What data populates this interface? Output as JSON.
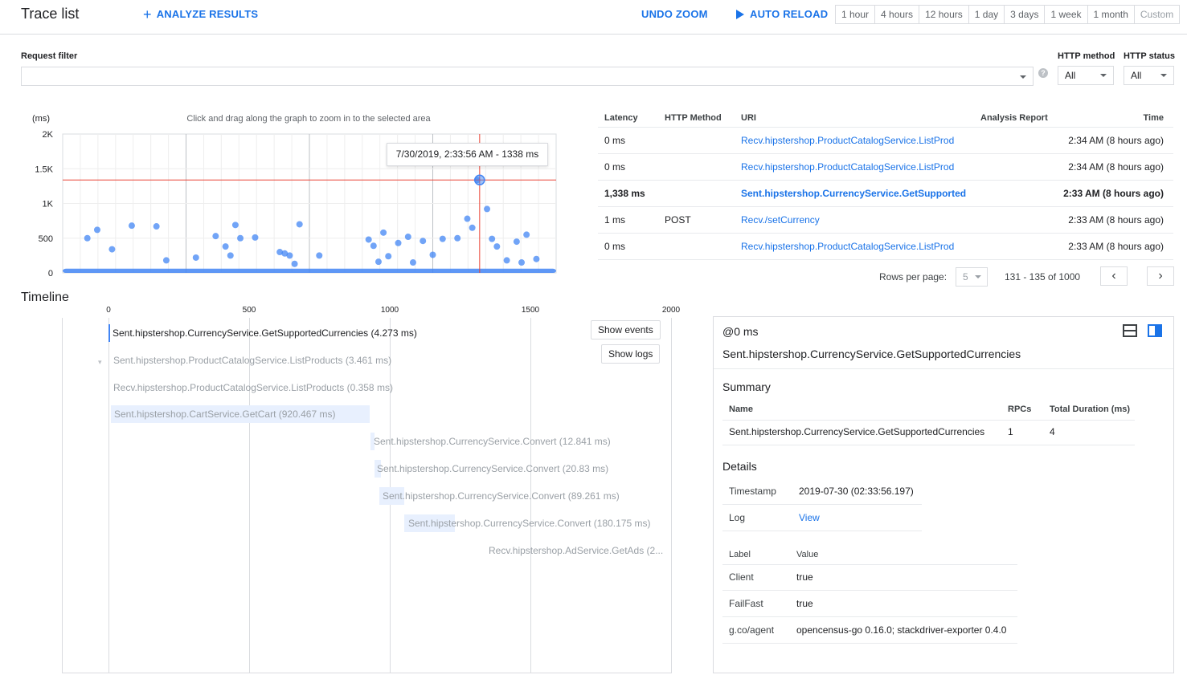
{
  "header": {
    "title": "Trace list",
    "analyze_label": "ANALYZE RESULTS",
    "undo_zoom_label": "UNDO ZOOM",
    "auto_reload_label": "AUTO RELOAD",
    "time_ranges": [
      "1 hour",
      "4 hours",
      "12 hours",
      "1 day",
      "3 days",
      "1 week",
      "1 month",
      "Custom"
    ]
  },
  "filter": {
    "request_filter_label": "Request filter",
    "help_glyph": "?",
    "http_method_label": "HTTP method",
    "http_method_value": "All",
    "http_status_label": "HTTP status",
    "http_status_value": "All"
  },
  "chart_data": {
    "type": "scatter",
    "ylabel": "(ms)",
    "instruction": "Click and drag along the graph to zoom in to the selected area",
    "y_ticks": [
      "2K",
      "1.5K",
      "1K",
      "500",
      "0"
    ],
    "ylim": [
      0,
      2000
    ],
    "xlim": [
      0,
      1
    ],
    "grid": true,
    "crosshair": {
      "x": 0.845,
      "y": 1338
    },
    "tooltip": "7/30/2019, 2:33:56 AM - 1338 ms",
    "points": [
      [
        0.05,
        500
      ],
      [
        0.07,
        620
      ],
      [
        0.1,
        340
      ],
      [
        0.14,
        680
      ],
      [
        0.19,
        670
      ],
      [
        0.21,
        180
      ],
      [
        0.27,
        220
      ],
      [
        0.31,
        530
      ],
      [
        0.33,
        380
      ],
      [
        0.34,
        250
      ],
      [
        0.35,
        690
      ],
      [
        0.36,
        500
      ],
      [
        0.39,
        510
      ],
      [
        0.44,
        300
      ],
      [
        0.45,
        280
      ],
      [
        0.46,
        250
      ],
      [
        0.47,
        130
      ],
      [
        0.48,
        700
      ],
      [
        0.52,
        250
      ],
      [
        0.62,
        480
      ],
      [
        0.63,
        390
      ],
      [
        0.64,
        160
      ],
      [
        0.65,
        580
      ],
      [
        0.66,
        240
      ],
      [
        0.68,
        430
      ],
      [
        0.7,
        520
      ],
      [
        0.71,
        150
      ],
      [
        0.73,
        460
      ],
      [
        0.75,
        260
      ],
      [
        0.77,
        490
      ],
      [
        0.8,
        500
      ],
      [
        0.82,
        780
      ],
      [
        0.83,
        650
      ],
      [
        0.84,
        1338
      ],
      [
        0.86,
        920
      ],
      [
        0.87,
        490
      ],
      [
        0.88,
        380
      ],
      [
        0.9,
        180
      ],
      [
        0.92,
        450
      ],
      [
        0.93,
        150
      ],
      [
        0.94,
        550
      ],
      [
        0.96,
        200
      ]
    ]
  },
  "trace_table": {
    "headers": [
      "Latency",
      "HTTP Method",
      "URI",
      "Analysis Report",
      "Time"
    ],
    "rows": [
      {
        "latency": "0 ms",
        "method": "",
        "uri": "Recv.hipstershop.ProductCatalogService.ListProd",
        "report": "",
        "time": "2:34 AM  (8 hours ago)"
      },
      {
        "latency": "0 ms",
        "method": "",
        "uri": "Recv.hipstershop.ProductCatalogService.ListProd",
        "report": "",
        "time": "2:34 AM  (8 hours ago)"
      },
      {
        "latency": "1,338 ms",
        "method": "",
        "uri": "Sent.hipstershop.CurrencyService.GetSupported",
        "report": "",
        "time": "2:33 AM  (8 hours ago)"
      },
      {
        "latency": "1 ms",
        "method": "POST",
        "uri": "Recv./setCurrency",
        "report": "",
        "time": "2:33 AM  (8 hours ago)"
      },
      {
        "latency": "0 ms",
        "method": "",
        "uri": "Recv.hipstershop.ProductCatalogService.ListProd",
        "report": "",
        "time": "2:33 AM  (8 hours ago)"
      }
    ],
    "rows_per_page_label": "Rows per page:",
    "rows_per_page": "5",
    "range_text": "131 - 135 of 1000",
    "prev_glyph": "‹",
    "next_glyph": "›"
  },
  "timeline": {
    "title": "Timeline",
    "ticks": [
      "0",
      "500",
      "1000",
      "1500",
      "2000"
    ],
    "show_events_label": "Show events",
    "show_logs_label": "Show logs",
    "spans": [
      {
        "label": "Sent.hipstershop.CurrencyService.GetSupportedCurrencies (4.273 ms)",
        "start": 0,
        "duration": 4.273
      },
      {
        "label": "Sent.hipstershop.ProductCatalogService.ListProducts (3.461 ms)",
        "start": 0,
        "duration": 3.461
      },
      {
        "label": "Recv.hipstershop.ProductCatalogService.ListProducts (0.358 ms)",
        "start": 0,
        "duration": 0.358
      },
      {
        "label": "Sent.hipstershop.CartService.GetCart (920.467 ms)",
        "start": 0,
        "duration": 920.467
      },
      {
        "label": "Sent.hipstershop.CurrencyService.Convert (12.841 ms)",
        "start": 930,
        "duration": 12.841
      },
      {
        "label": "Sent.hipstershop.CurrencyService.Convert (20.83 ms)",
        "start": 945,
        "duration": 20.83
      },
      {
        "label": "Sent.hipstershop.CurrencyService.Convert (89.261 ms)",
        "start": 968,
        "duration": 89.261
      },
      {
        "label": "Sent.hipstershop.CurrencyService.Convert (180.175 ms)",
        "start": 1060,
        "duration": 180.175
      },
      {
        "label": "Recv.hipstershop.AdService.GetAds (2...",
        "start": 1270,
        "duration": 0
      }
    ]
  },
  "details": {
    "offset": "@0 ms",
    "span_name": "Sent.hipstershop.CurrencyService.GetSupportedCurrencies",
    "summary_title": "Summary",
    "summary_headers": [
      "Name",
      "RPCs",
      "Total Duration (ms)"
    ],
    "summary_row": {
      "name": "Sent.hipstershop.CurrencyService.GetSupportedCurrencies",
      "rpcs": "1",
      "total": "4"
    },
    "details_title": "Details",
    "timestamp_label": "Timestamp",
    "timestamp_value": "2019-07-30 (02:33:56.197)",
    "log_label": "Log",
    "log_link": "View",
    "label_header": "Label",
    "value_header": "Value",
    "labels": [
      {
        "label": "Client",
        "value": "true"
      },
      {
        "label": "FailFast",
        "value": "true"
      },
      {
        "label": "g.co/agent",
        "value": "opencensus-go 0.16.0; stackdriver-exporter 0.4.0"
      }
    ]
  },
  "colors": {
    "accent": "#1a73e8",
    "point": "#4285f4",
    "crosshair": "#ea4335",
    "span_bar": "#e8f0fe"
  }
}
